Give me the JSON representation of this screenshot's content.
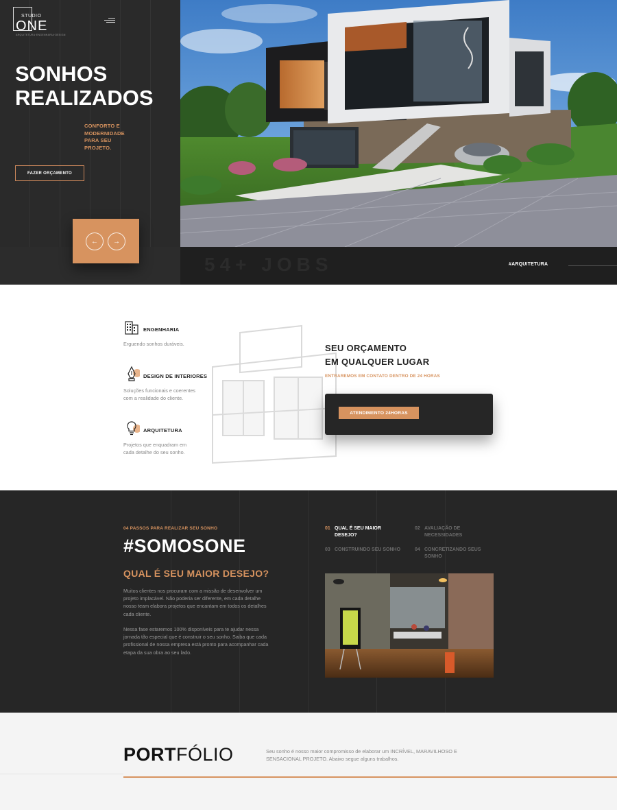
{
  "brand": {
    "studio": "STUDIO",
    "name": "ONE",
    "tagline": "ARQUITETURA·ENGENHARIA·DESIGN"
  },
  "hero": {
    "title": "SONHOS\nREALIZADOS",
    "subtitle": "CONFORTO E\nMODERNIDADE\nPARA SEU\nPROJETO.",
    "cta_label": "FAZER ORÇAMENTO",
    "prev_arrow": "←",
    "next_arrow": "→",
    "jobs_text": "54+ JOBS",
    "category_tag": "#ARQUITETURA"
  },
  "services": {
    "items": [
      {
        "title": "ENGENHARIA",
        "desc": "Erguendo sonhos duráveis.",
        "icon": "building-icon"
      },
      {
        "title": "DESIGN DE INTERIORES",
        "desc": "Soluções funcionais e coerentes\ncom a realidade do cliente.",
        "icon": "pen-nib-icon"
      },
      {
        "title": "ARQUITETURA",
        "desc": "Projetos que enquadram em\ncada detalhe do seu sonho.",
        "icon": "lightbulb-icon"
      }
    ],
    "quote_title": "SEU ORÇAMENTO\nEM QUALQUER LUGAR",
    "quote_sub": "ENTRAREMOS EM CONTATO DENTRO DE 24 HORAS",
    "quote_button": "ATENDIMENTO 24HORAS"
  },
  "steps": {
    "kicker": "04 PASSOS PARA REALIZAR SEU SONHO",
    "title_prefix": "#SOMOS",
    "title_bold": "ONE",
    "question": "QUAL É SEU MAIOR DESEJO?",
    "paragraph1": "Muitos clientes nos procuram com a missão de desenvolver um projeto implacável. Não poderia ser diferente, em cada detalhe nosso team elabora projetos que encantam em todos os detalhes cada cliente.",
    "paragraph2": "Nessa fase estaremos 100% disponíveis para te ajudar nessa jornada tão especial que é construir o seu sonho. Saiba que cada profissional de nossa empresa está pronto para acompanhar cada etapa da sua obra ao seu lado.",
    "tabs": [
      {
        "num": "01",
        "label": "QUAL É SEU MAIOR\nDESEJO?"
      },
      {
        "num": "02",
        "label": "AVALIAÇÃO DE\nNECESSIDADES"
      },
      {
        "num": "03",
        "label": "CONSTRUINDO SEU SONHO"
      },
      {
        "num": "04",
        "label": "CONCRETIZANDO SEUS\nSONHO"
      }
    ]
  },
  "portfolio": {
    "title_bold": "PORT",
    "title_rest": "FÓLIO",
    "description": "Seu sonho é nosso maior compromisso de elaborar um INCRÍVEL, MARAVILHOSO E SENSACIONAL PROJETO. Abaixo segue alguns trabalhos."
  },
  "colors": {
    "accent": "#d7935f",
    "dark": "#262626",
    "light": "#f4f4f4"
  }
}
